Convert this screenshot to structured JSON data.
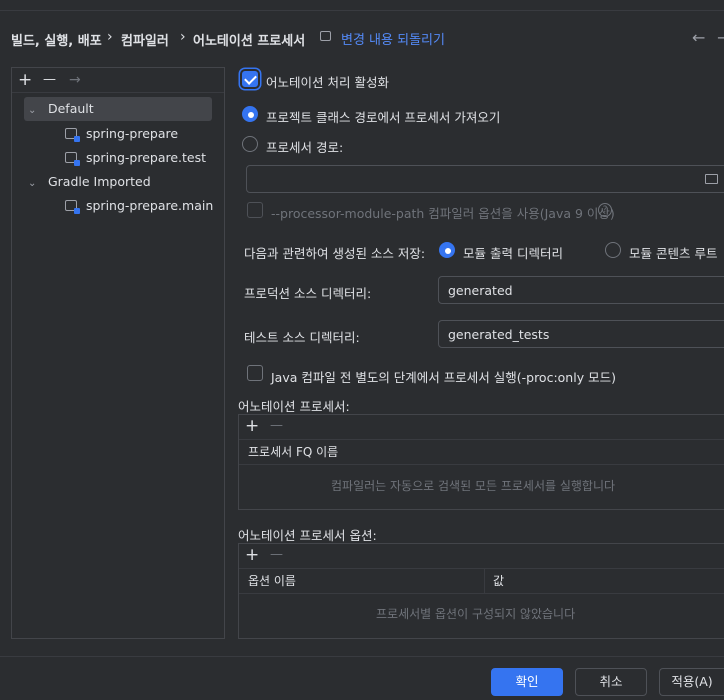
{
  "breadcrumb": {
    "items": [
      "빌드, 실행, 배포",
      "컴파일러",
      "어노테이션 프로세서"
    ],
    "separator": "›",
    "revert_label": "변경 내용 되돌리기"
  },
  "nav": {
    "back_icon": "arrow-left-icon",
    "forward_icon": "arrow-right-icon"
  },
  "left_toolbar": {
    "add": "+",
    "remove": "—",
    "move": "→"
  },
  "tree": {
    "profiles": [
      {
        "label": "Default",
        "expanded": true,
        "selected": true,
        "modules": [
          "spring-prepare",
          "spring-prepare.test"
        ]
      },
      {
        "label": "Gradle Imported",
        "expanded": true,
        "selected": false,
        "modules": [
          "spring-prepare.main"
        ]
      }
    ]
  },
  "settings": {
    "enable_processing": {
      "label": "어노테이션 처리 활성화",
      "checked": true
    },
    "obtain_from_classpath": {
      "label": "프로젝트 클래스 경로에서 프로세서 가져오기",
      "selected": true
    },
    "processor_path": {
      "label": "프로세서 경로:",
      "selected": false,
      "value": ""
    },
    "module_path_option": {
      "label": "--processor-module-path 컴파일러 옵션을 사용(Java 9 이상)",
      "checked": false,
      "help": "?"
    },
    "store_sources_label": "다음과 관련하여 생성된 소스 저장:",
    "store_options": [
      {
        "label": "모듈 출력 디렉터리",
        "selected": true
      },
      {
        "label": "모듈 콘텐츠 루트",
        "selected": false
      }
    ],
    "production_dir": {
      "label": "프로덕션 소스 디렉터리:",
      "value": "generated"
    },
    "test_dir": {
      "label": "테스트 소스 디렉터리:",
      "value": "generated_tests"
    },
    "run_separately": {
      "label": "Java 컴파일 전 별도의 단계에서 프로세서 실행(-proc:only 모드)",
      "checked": false
    }
  },
  "processors_table": {
    "title": "어노테이션 프로세서:",
    "column": "프로세서 FQ 이름",
    "empty_text": "컴파일러는 자동으로 검색된 모든 프로세서를 실행합니다",
    "add": "+",
    "remove": "—"
  },
  "options_table": {
    "title": "어노테이션 프로세서 옵션:",
    "columns": [
      "옵션 이름",
      "값"
    ],
    "empty_text": "프로세서별 옵션이 구성되지 않았습니다",
    "add": "+",
    "remove": "—"
  },
  "footer": {
    "ok": "확인",
    "cancel": "취소",
    "apply": "적용(A)"
  },
  "colors": {
    "accent": "#3574f0",
    "link": "#548af7",
    "background": "#2b2d30",
    "text": "#dfe1e5",
    "muted": "#6f737a"
  }
}
